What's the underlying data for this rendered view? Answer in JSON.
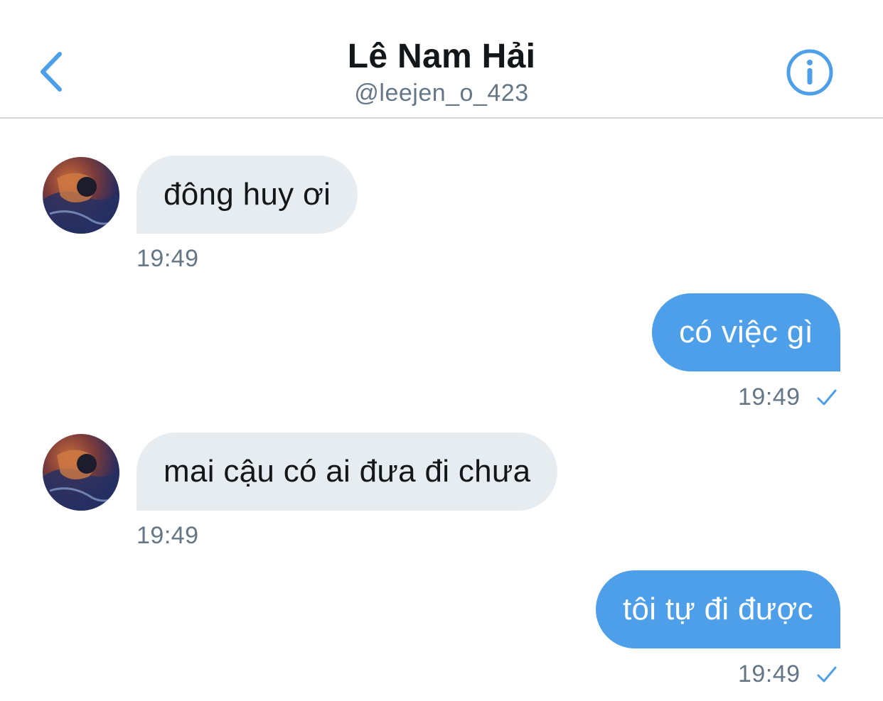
{
  "header": {
    "name": "Lê Nam Hải",
    "handle": "@leejen_o_423",
    "back_icon": "chevron-left-icon",
    "info_icon": "info-circle-icon",
    "accent_color": "#4d9fea"
  },
  "messages": [
    {
      "direction": "incoming",
      "text": "đông huy ơi",
      "time": "19:49"
    },
    {
      "direction": "outgoing",
      "text": "có việc gì",
      "time": "19:49",
      "status_icon": "check-icon"
    },
    {
      "direction": "incoming",
      "text": "mai cậu có ai đưa đi chưa",
      "time": "19:49"
    },
    {
      "direction": "outgoing",
      "text": "tôi tự đi được",
      "time": "19:49",
      "status_icon": "check-icon"
    }
  ],
  "colors": {
    "incoming_bubble": "#e6ecf0",
    "outgoing_bubble": "#4d9fea",
    "timestamp": "#657786",
    "title": "#14171a"
  }
}
